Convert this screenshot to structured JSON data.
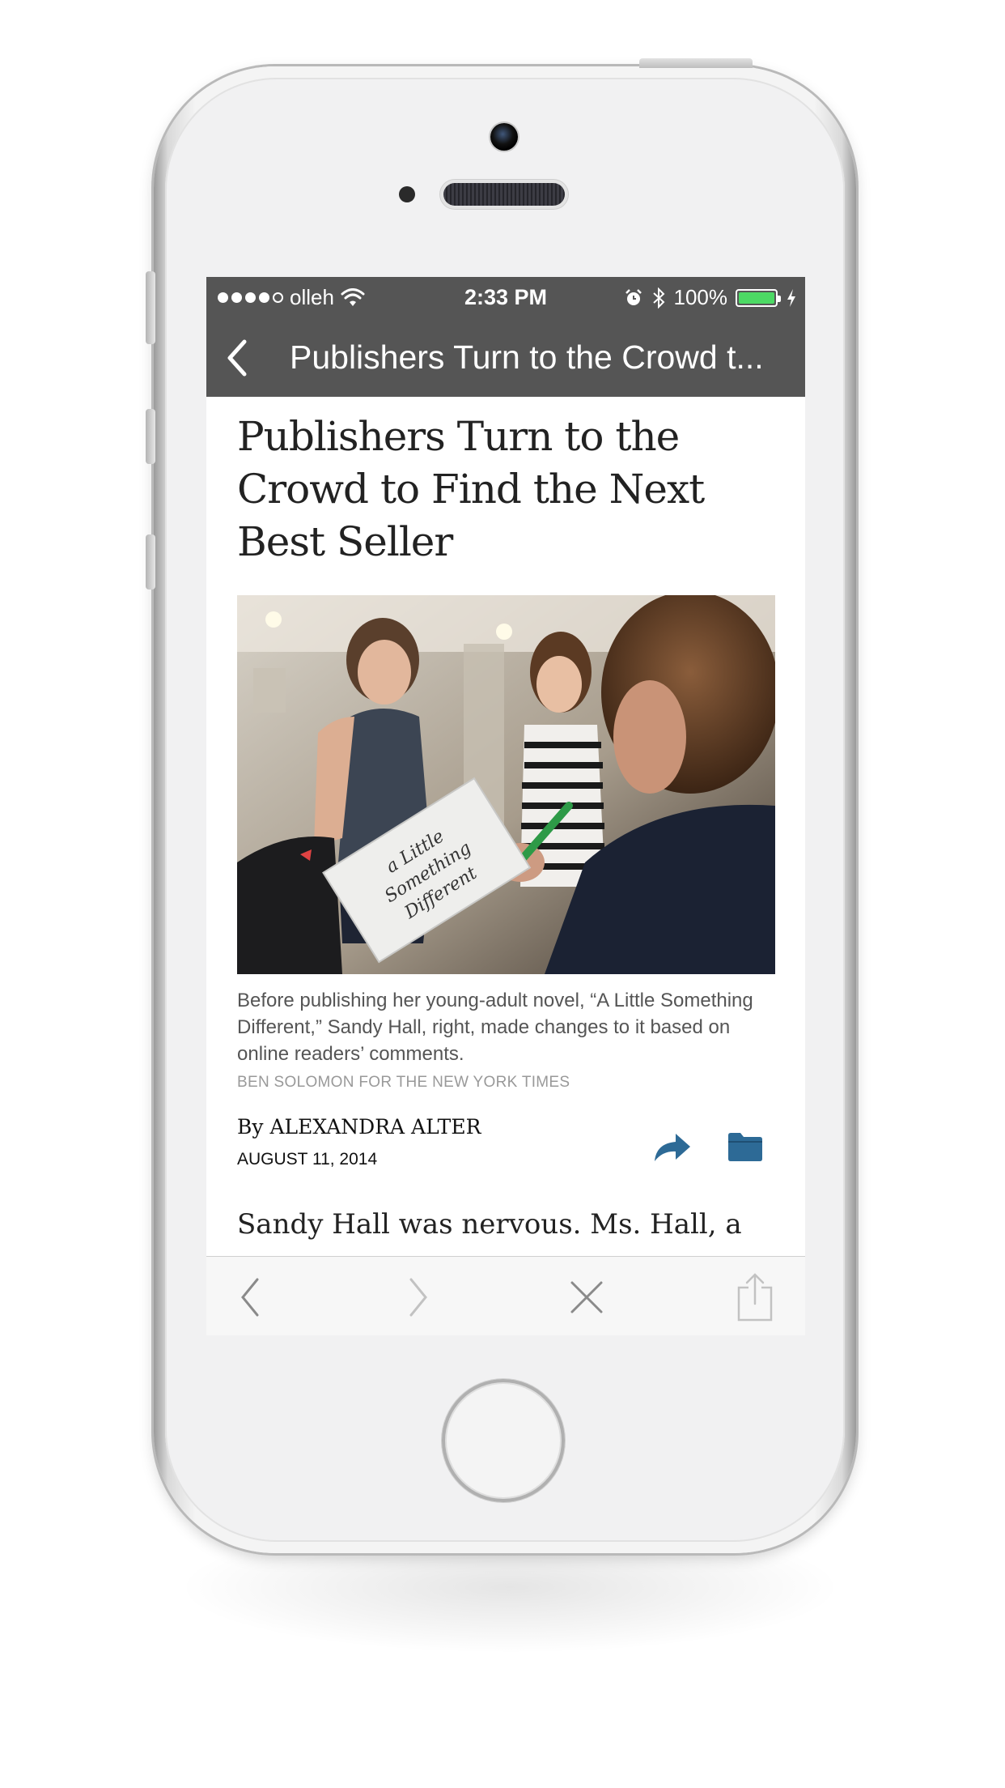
{
  "status_bar": {
    "carrier": "olleh",
    "time": "2:33 PM",
    "battery_percent": "100%",
    "battery_level": 1.0,
    "signal_bars_filled": 4,
    "signal_bars_total": 5,
    "icons": [
      "wifi-icon",
      "alarm-icon",
      "bluetooth-icon",
      "battery-icon",
      "charging-icon"
    ],
    "battery_color": "#4cd964"
  },
  "nav_bar": {
    "title": "Publishers Turn to the Crowd t...",
    "back_icon": "chevron-left-icon",
    "background": "#555555"
  },
  "article": {
    "headline": "Publishers Turn to the Crowd to Find the Next Best Seller",
    "photo_description_icon": "photo",
    "caption": "Before publishing her young-adult novel, “A Little Something Different,” Sandy Hall, right, made changes to it based on online readers’ comments.",
    "credit": "BEN SOLOMON FOR THE NEW YORK TIMES",
    "byline": "By ALEXANDRA ALTER",
    "date": "AUGUST 11, 2014",
    "lede": "Sandy Hall was nervous. Ms. Hall, a",
    "action_color": "#2d6a96",
    "actions": [
      "share-icon",
      "folder-icon"
    ],
    "book_cover_text": [
      "a Little",
      "Something",
      "Different"
    ]
  },
  "toolbar": {
    "buttons": [
      "back-arrow-icon",
      "forward-arrow-icon",
      "close-icon",
      "share-icon"
    ]
  }
}
